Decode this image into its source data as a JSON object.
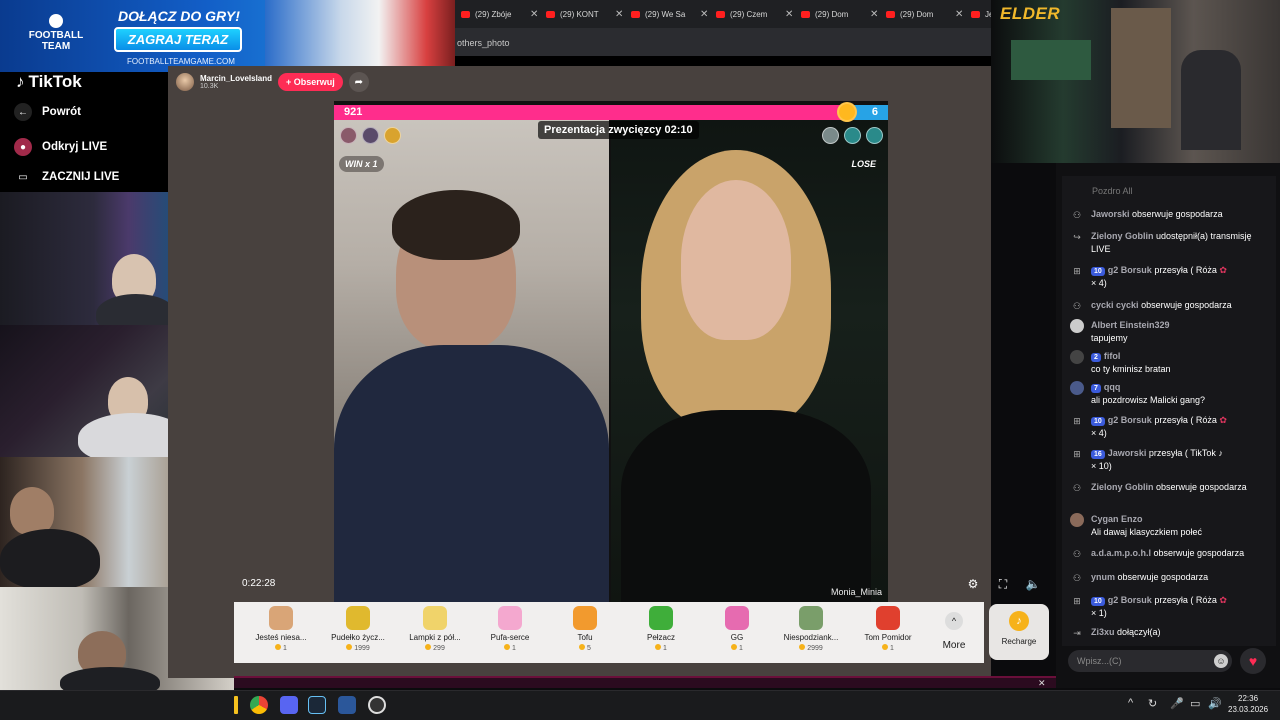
{
  "ad": {
    "brand_line1": "FOOTBALL",
    "brand_line2": "TEAM",
    "headline": "DOŁĄCZ DO GRY!",
    "cta": "ZAGRAJ TERAZ",
    "site": "FOOTBALLTEAMGAME.COM"
  },
  "browser": {
    "tabs": [
      {
        "label": "(29) Zbóje"
      },
      {
        "label": "(29) KONT"
      },
      {
        "label": "(29) We Sa"
      },
      {
        "label": "(29) Czem"
      },
      {
        "label": "(29) Dom"
      },
      {
        "label": "(29) Dom"
      },
      {
        "label": "Je"
      }
    ],
    "url_fragment": "others_photo"
  },
  "sidebar": {
    "brand": "TikTok",
    "back": "Powrót",
    "discover": "Odkryj LIVE",
    "go_live": "ZACZNIJ LIVE"
  },
  "host": {
    "name": "Marcin_LoveIsland",
    "followers": "10.3K",
    "follow_label": "+ Obserwuj"
  },
  "battle": {
    "score_left": "921",
    "score_right": "6",
    "timer": "Prezentacja zwycięzcy 02:10",
    "win_badge": "WIN x 1",
    "lose_badge": "LOSE",
    "right_streamer": "Monia_Minia",
    "elapsed": "0:22:28"
  },
  "gifts": [
    {
      "name": "Jesteś niesa...",
      "price": "1",
      "color": "#d9a577"
    },
    {
      "name": "Pudełko życz...",
      "price": "1999",
      "color": "#e0b92e"
    },
    {
      "name": "Lampki z pół...",
      "price": "299",
      "color": "#f0d36a"
    },
    {
      "name": "Pufa-serce",
      "price": "1",
      "color": "#f4a8cf"
    },
    {
      "name": "Tofu",
      "price": "5",
      "color": "#f29a2e"
    },
    {
      "name": "Pełzacz",
      "price": "1",
      "color": "#3fae3a"
    },
    {
      "name": "GG",
      "price": "1",
      "color": "#e66bb0"
    },
    {
      "name": "Niespodziank...",
      "price": "2999",
      "color": "#7a9e6a"
    },
    {
      "name": "Tom Pomidor",
      "price": "1",
      "color": "#e0402e"
    }
  ],
  "gift_more": "More",
  "recharge": "Recharge",
  "elder_overlay": "ELDER",
  "chat": {
    "top_stub": "Pozdro All",
    "messages": [
      {
        "icon": "follow",
        "user": "Jaworski",
        "text": "obserwuje gospodarza"
      },
      {
        "icon": "share",
        "user": "Zielony Goblin",
        "text": "udostępnił(a) transmisję LIVE"
      },
      {
        "icon": "gift",
        "level": "10",
        "user": "g2 Borsuk",
        "text": "przesyła ( Róża",
        "extra": "× 4)"
      },
      {
        "icon": "follow",
        "user": "cycki cycki",
        "text": "obserwuje gospodarza"
      },
      {
        "icon": "avatar",
        "user": "Albert Einstein329",
        "text": "tapujemy"
      },
      {
        "icon": "avatar",
        "level": "2",
        "user": "fifol",
        "text": "co ty kminisz bratan"
      },
      {
        "icon": "avatar",
        "level": "7",
        "user": "qqq",
        "text": "ali pozdrowisz Malicki gang?"
      },
      {
        "icon": "gift",
        "level": "10",
        "user": "g2 Borsuk",
        "text": "przesyła ( Róża",
        "extra": "× 4)"
      },
      {
        "icon": "gift",
        "level": "16",
        "user": "Jaworski",
        "text": "przesyła ( TikTok",
        "extra": "× 10)"
      },
      {
        "icon": "follow",
        "user": "Zielony Goblin",
        "text": "obserwuje gospodarza"
      },
      {
        "icon": "avatar",
        "user": "Cygan Enzo",
        "text": "Ali dawaj klasyczkiem połeć"
      },
      {
        "icon": "follow",
        "user": "a.d.a.m.p.o.h.l",
        "text": "obserwuje gospodarza"
      },
      {
        "icon": "follow",
        "user": "ynum",
        "text": "obserwuje gospodarza"
      },
      {
        "icon": "gift",
        "level": "10",
        "user": "g2 Borsuk",
        "text": "przesyła ( Róża",
        "extra": "× 1)"
      },
      {
        "icon": "join",
        "user": "Zi3xu",
        "text": "dołączył(a)"
      }
    ],
    "input_placeholder": "Wpisz...(C)"
  },
  "taskbar": {
    "time": "22:36",
    "date": "23.03.2026"
  }
}
